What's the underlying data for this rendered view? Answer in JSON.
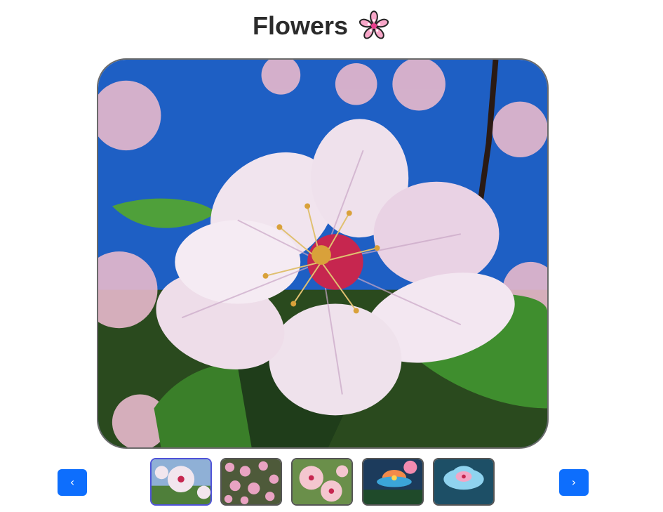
{
  "title": "Flowers",
  "title_icon": "cherry-blossom-icon",
  "main_image": {
    "description_icon": "cherry-blossom-photo",
    "colors": {
      "sky": "#1e5fc4",
      "petal": "#f1e4ee",
      "petal_shadow": "#c9a6c6",
      "center": "#c6264f",
      "leaf": "#3f8e2e"
    }
  },
  "navigation": {
    "prev_label": "‹",
    "next_label": "›"
  },
  "thumbnails": [
    {
      "name": "thumb-white-blossom",
      "active": true
    },
    {
      "name": "thumb-pink-cluster",
      "active": false
    },
    {
      "name": "thumb-pink-flowers",
      "active": false
    },
    {
      "name": "thumb-lotus-sunset",
      "active": false
    },
    {
      "name": "thumb-blue-flower",
      "active": false
    }
  ],
  "accent_color": "#0d6efd"
}
